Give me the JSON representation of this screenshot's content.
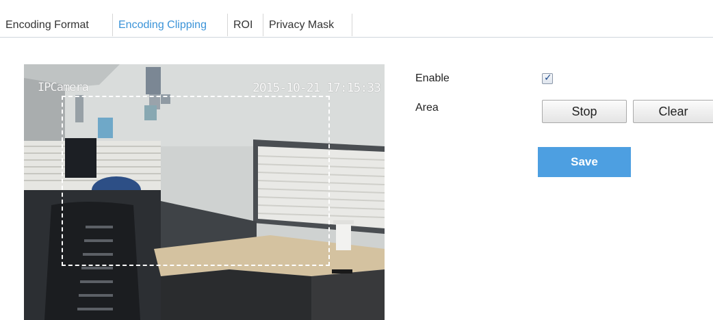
{
  "tabs": {
    "encoding_format": "Encoding Format",
    "encoding_clipping": "Encoding Clipping",
    "roi": "ROI",
    "privacy_mask": "Privacy Mask",
    "active": "Encoding Clipping"
  },
  "video": {
    "osd_name": "IPCamera",
    "osd_time": "2015-10-21 17:15:33"
  },
  "form": {
    "enable_label": "Enable",
    "enable_checked": true,
    "area_label": "Area",
    "stop_label": "Stop",
    "clear_label": "Clear",
    "save_label": "Save"
  },
  "colors": {
    "accent": "#3a93d8",
    "save_button": "#4d9fe1"
  }
}
